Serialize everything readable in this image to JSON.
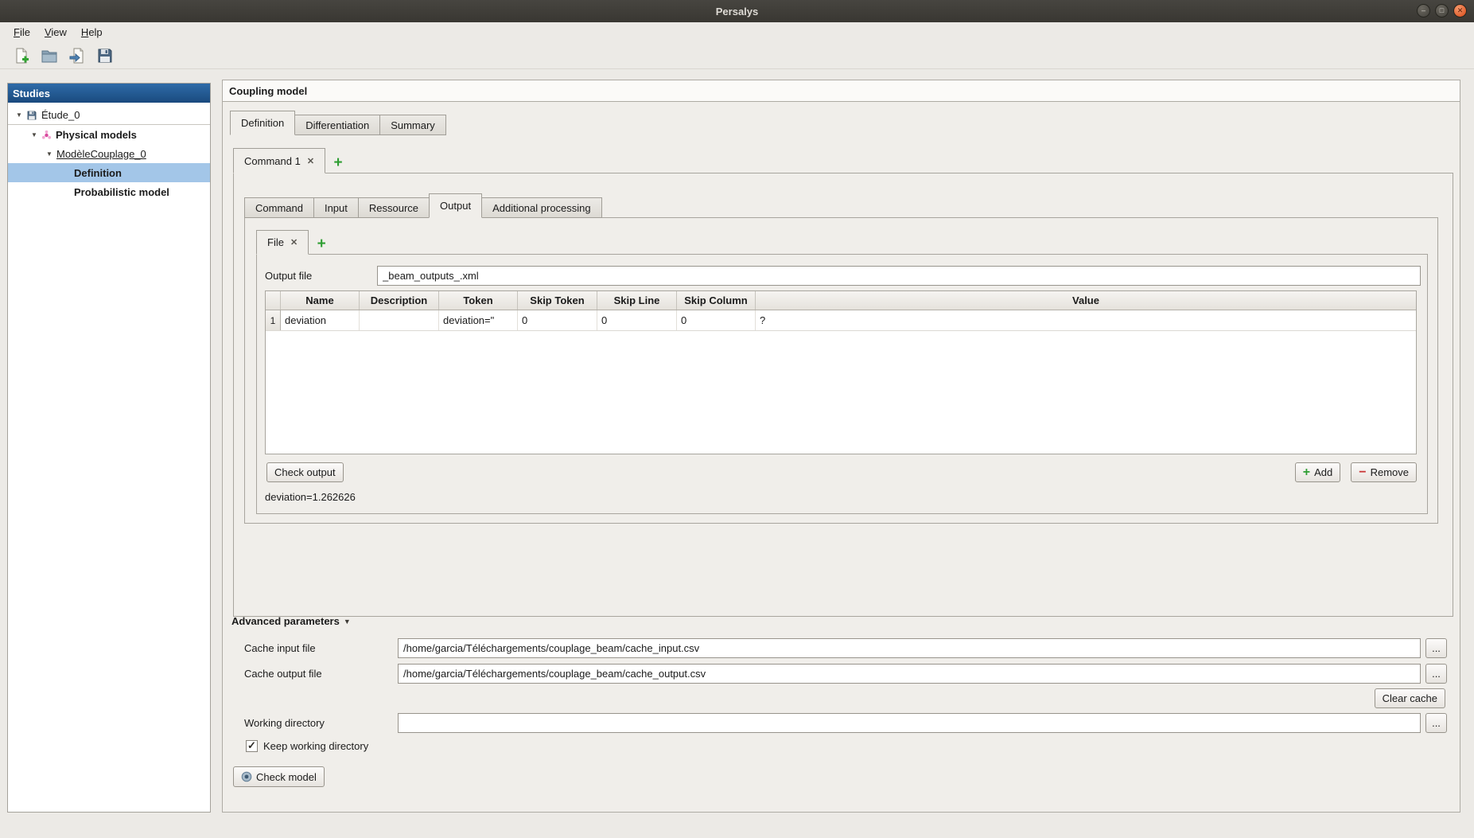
{
  "window": {
    "title": "Persalys",
    "controls": {
      "minimize": "–",
      "maximize": "□",
      "close": "✕"
    }
  },
  "menubar": {
    "items": [
      "File",
      "View",
      "Help"
    ]
  },
  "toolbar": {
    "buttons": [
      "new-study",
      "open-study",
      "import-script",
      "save-study"
    ]
  },
  "sidebar": {
    "title": "Studies",
    "items": [
      {
        "label": "Étude_0"
      },
      {
        "label": "Physical models"
      },
      {
        "label": "ModèleCouplage_0"
      },
      {
        "label": "Definition"
      },
      {
        "label": "Probabilistic model"
      }
    ]
  },
  "main": {
    "title": "Coupling model",
    "tabs": [
      "Definition",
      "Differentiation",
      "Summary"
    ],
    "command_tab": "Command 1",
    "subtabs": [
      "Command",
      "Input",
      "Ressource",
      "Output",
      "Additional processing"
    ],
    "file_tab": "File",
    "output_file": {
      "label": "Output file",
      "value": "_beam_outputs_.xml"
    },
    "table": {
      "columns": [
        "Name",
        "Description",
        "Token",
        "Skip Token",
        "Skip Line",
        "Skip Column",
        "Value"
      ],
      "rows": [
        {
          "num": "1",
          "name": "deviation",
          "description": "",
          "token": "deviation=\"",
          "skip_token": "0",
          "skip_line": "0",
          "skip_column": "0",
          "value": "?"
        }
      ]
    },
    "buttons": {
      "check_output": "Check output",
      "add": "Add",
      "remove": "Remove",
      "browse": "...",
      "clear_cache": "Clear cache",
      "check_model": "Check model"
    },
    "result_text": "deviation=1.262626",
    "advanced": {
      "title": "Advanced parameters",
      "cache_input_label": "Cache input file",
      "cache_input_value": "/home/garcia/Téléchargements/couplage_beam/cache_input.csv",
      "cache_output_label": "Cache output file",
      "cache_output_value": "/home/garcia/Téléchargements/couplage_beam/cache_output.csv",
      "working_directory_label": "Working directory",
      "working_directory_value": "",
      "keep_working_directory_label": "Keep working directory",
      "keep_working_directory_checked": true
    }
  },
  "icons": {
    "close_tab": "✕",
    "add": "+",
    "remove": "−",
    "tree_expanded": "▼",
    "collapse": "▼",
    "check": "✓"
  }
}
